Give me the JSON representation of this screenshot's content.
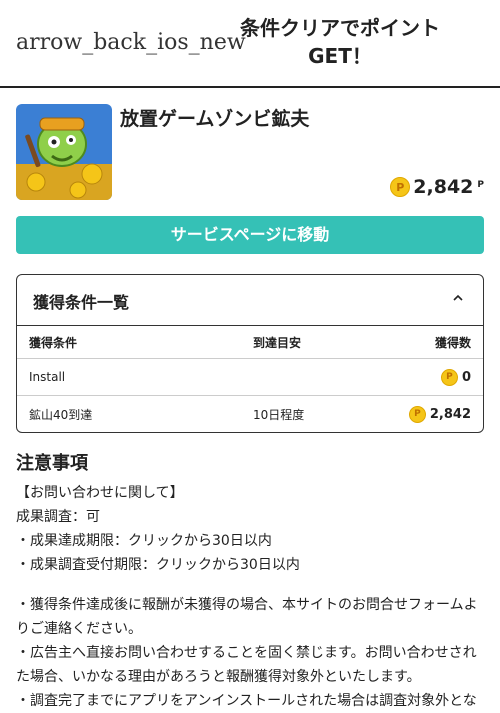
{
  "header": {
    "back_text": "arrow_back_ios_new",
    "title": "条件クリアでポイントGET！"
  },
  "app": {
    "name": "放置ゲームゾンビ鉱夫",
    "points": "2,842",
    "points_unit": "P",
    "coin_glyph": "P"
  },
  "service_button": "サービスページに移動",
  "conditions": {
    "title": "獲得条件一覧",
    "columns": [
      "獲得条件",
      "到達目安",
      "獲得数"
    ],
    "rows": [
      {
        "condition": "Install",
        "estimate": "",
        "reward": "0"
      },
      {
        "condition": "鉱山40到達",
        "estimate": "10日程度",
        "reward": "2,842"
      }
    ]
  },
  "notes": {
    "title": "注意事項",
    "lines": [
      "【お問い合わせに関して】",
      "成果調査：可",
      "・成果達成期限：クリックから30日以内",
      "・成果調査受付期限：クリックから30日以内"
    ],
    "lines2": [
      "・獲得条件達成後に報酬が未獲得の場合、本サイトのお問合せフォームよりご連絡ください。",
      "・広告主へ直接お問い合わせすることを固く禁じます。お問い合わせされた場合、いかなる理由があろうと報酬獲得対象外といたします。",
      "・調査完了までにアプリをアンインストールされた場合は調査対象外とな"
    ]
  },
  "colors": {
    "accent": "#35c1b6",
    "coin": "#f5c518"
  }
}
